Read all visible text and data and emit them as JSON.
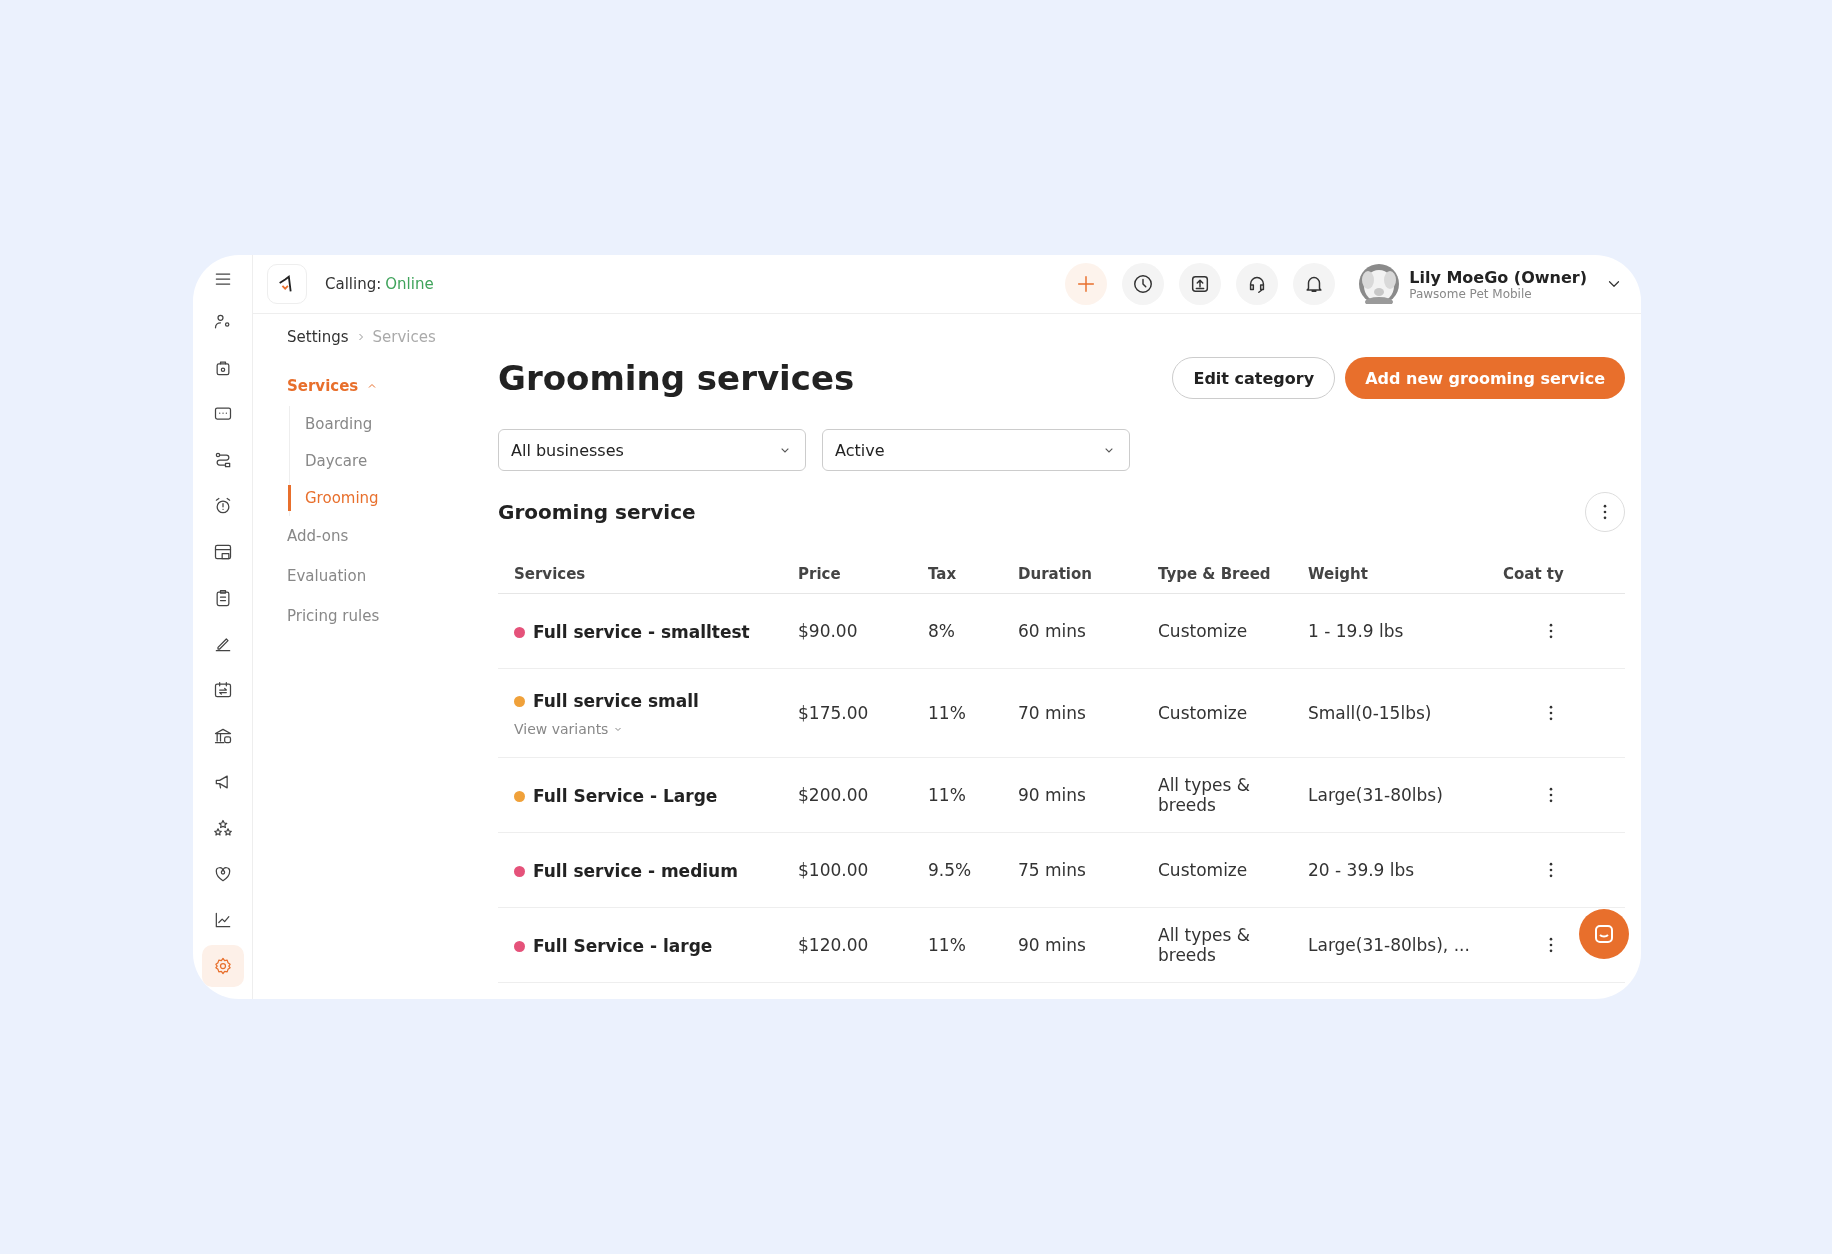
{
  "sidebar": {
    "items": [
      {
        "selected": false
      },
      {
        "selected": false
      },
      {
        "selected": false
      },
      {
        "selected": false
      },
      {
        "selected": false
      },
      {
        "selected": false
      },
      {
        "selected": false
      },
      {
        "selected": false
      },
      {
        "selected": false
      },
      {
        "selected": false
      },
      {
        "selected": false
      },
      {
        "selected": false
      },
      {
        "selected": false
      },
      {
        "selected": false
      },
      {
        "selected": true
      }
    ]
  },
  "topbar": {
    "calling_label": "Calling:",
    "calling_status": "Online",
    "user_name": "Lily MoeGo (Owner)",
    "business": "Pawsome Pet Mobile"
  },
  "breadcrumb": [
    {
      "label": "Settings",
      "current": false
    },
    {
      "label": "Services",
      "current": true
    }
  ],
  "nav": [
    {
      "label": "Services",
      "selected": true,
      "expanded": true,
      "children": [
        {
          "label": "Boarding",
          "selected": false
        },
        {
          "label": "Daycare",
          "selected": false
        },
        {
          "label": "Grooming",
          "selected": true
        }
      ]
    },
    {
      "label": "Add-ons",
      "selected": false
    },
    {
      "label": "Evaluation",
      "selected": false
    },
    {
      "label": "Pricing rules",
      "selected": false
    }
  ],
  "page": {
    "title": "Grooming services",
    "buttons": [
      {
        "label": "Edit category",
        "kind": "secondary"
      },
      {
        "label": "Add new grooming service",
        "kind": "primary"
      }
    ]
  },
  "filters": [
    {
      "value": "All businesses"
    },
    {
      "value": "Active"
    }
  ],
  "section": {
    "title": "Grooming service"
  },
  "table": {
    "columns": [
      "Services",
      "Price",
      "Tax",
      "Duration",
      "Type & Breed",
      "Weight",
      "Coat ty"
    ],
    "rows": [
      {
        "service": "Full service - smalltest",
        "color": "#e5527a",
        "price": "$90.00",
        "tax": "8%",
        "duration": "60 mins",
        "type_breed": "Customize",
        "weight": "1 - 19.9 lbs"
      },
      {
        "service": "Full service small",
        "color": "#f0a13a",
        "price": "$175.00",
        "tax": "11%",
        "duration": "70 mins",
        "type_breed": "Customize",
        "weight": "Small(0-15lbs)",
        "variants_link": "View variants"
      },
      {
        "service": "Full Service - Large",
        "color": "#f0a13a",
        "price": "$200.00",
        "tax": "11%",
        "duration": "90 mins",
        "type_breed": "All types & breeds",
        "weight": "Large(31-80lbs)"
      },
      {
        "service": "Full service - medium",
        "color": "#e5527a",
        "price": "$100.00",
        "tax": "9.5%",
        "duration": "75 mins",
        "type_breed": "Customize",
        "weight": "20 - 39.9 lbs"
      },
      {
        "service": "Full Service - large",
        "color": "#e5527a",
        "price": "$120.00",
        "tax": "11%",
        "duration": "90 mins",
        "type_breed": "All types & breeds",
        "weight": "Large(31-80lbs), ..."
      }
    ]
  }
}
